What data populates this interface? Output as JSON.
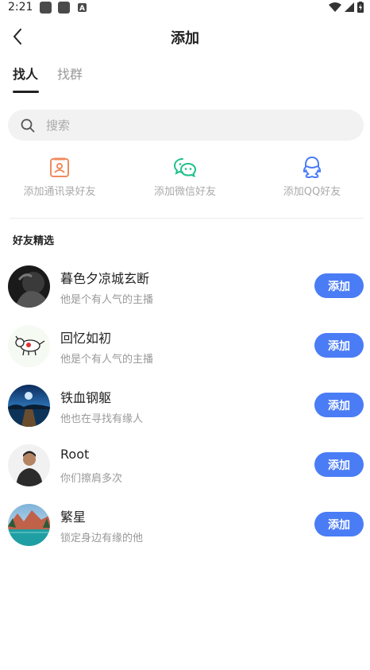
{
  "status_bar": {
    "time": "2:21",
    "icon_letter": "A"
  },
  "header": {
    "title": "添加"
  },
  "tabs": [
    {
      "label": "找人",
      "active": true
    },
    {
      "label": "找群",
      "active": false
    }
  ],
  "search": {
    "placeholder": "搜索"
  },
  "quick_actions": [
    {
      "label": "添加通讯录好友",
      "icon": "contacts-book-icon",
      "color": "#f08a5d"
    },
    {
      "label": "添加微信好友",
      "icon": "wechat-icon",
      "color": "#1ec08a"
    },
    {
      "label": "添加QQ好友",
      "icon": "qq-icon",
      "color": "#4a7cf5"
    }
  ],
  "section_title": "好友精选",
  "friends": [
    {
      "name": "暮色夕凉城玄断",
      "desc": "他是个有人气的主播",
      "button": "添加"
    },
    {
      "name": "回忆如初",
      "desc": "他是个有人气的主播",
      "button": "添加"
    },
    {
      "name": "铁血钢躯",
      "desc": "他也在寻找有缘人",
      "button": "添加"
    },
    {
      "name": "Root",
      "desc": "你们擦肩多次",
      "button": "添加"
    },
    {
      "name": "繁星",
      "desc": "锁定身边有缘的他",
      "button": "添加"
    }
  ],
  "colors": {
    "accent": "#4a7cf5",
    "text": "#222222",
    "muted": "#999999"
  }
}
